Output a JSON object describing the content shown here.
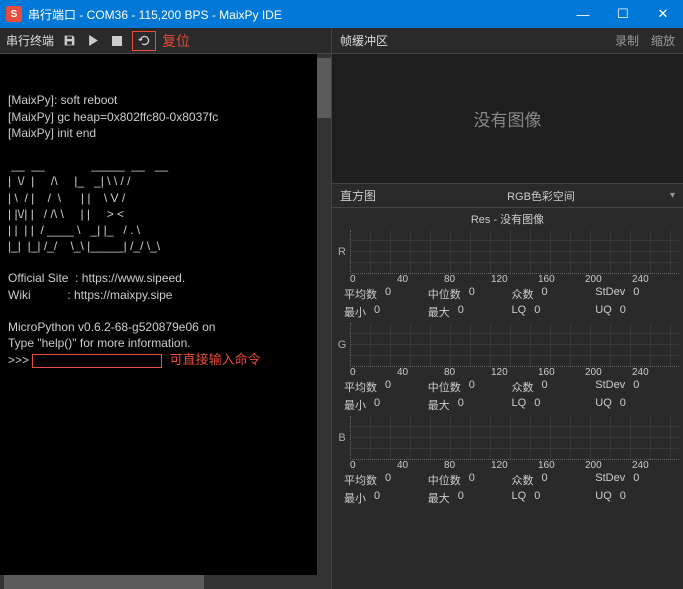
{
  "titlebar": {
    "app_icon": "S",
    "title": "串行端口 - COM36 - 115,200 BPS - MaixPy IDE"
  },
  "win": {
    "min": "—",
    "max": "☐",
    "close": "✕"
  },
  "left_toolbar": {
    "label": "串行终端",
    "annotation_reset": "复位",
    "annotation_input": "可直接输入命令"
  },
  "terminal_text": "[MaixPy]: soft reboot\n[MaixPy] gc heap=0x802ffc80-0x8037fc\n[MaixPy] init end\n\n __  __              _____  __   __\n|  \\/  |     /\\     |_   _| \\ \\ / /\n| \\  / |    /  \\      | |    \\ V /\n| |\\/| |   / /\\ \\     | |     > <\n| |  | |  / ____ \\   _| |_   / . \\\n|_|  |_| /_/    \\_\\ |_____| /_/ \\_\\\n\nOfficial Site  : https://www.sipeed.\nWiki           : https://maixpy.sipe\n\nMicroPython v0.6.2-68-g520879e06 on \nType \"help()\" for more information.",
  "prompt": ">>> ",
  "right_toolbar": {
    "label": "帧缓冲区",
    "rec": "录制",
    "zoom": "缩放"
  },
  "noimage": "没有图像",
  "histogram": {
    "label": "直方图",
    "colorspace": "RGB色彩空间",
    "res_prefix": "Res  - ",
    "res_value": "没有图像"
  },
  "x_ticks": [
    "0",
    "40",
    "80",
    "120",
    "160",
    "200",
    "240"
  ],
  "channels": [
    "R",
    "G",
    "B"
  ],
  "stat_labels": {
    "mean": "平均数",
    "median": "中位数",
    "mode": "众数",
    "stdev": "StDev",
    "min": "最小",
    "max": "最大",
    "lq": "LQ",
    "uq": "UQ"
  },
  "stat_zero": "0",
  "chart_data": [
    {
      "channel": "R",
      "type": "bar",
      "x_range": [
        0,
        255
      ],
      "values": [],
      "stats": {
        "mean": 0,
        "median": 0,
        "mode": 0,
        "stdev": 0,
        "min": 0,
        "max": 0,
        "lq": 0,
        "uq": 0
      }
    },
    {
      "channel": "G",
      "type": "bar",
      "x_range": [
        0,
        255
      ],
      "values": [],
      "stats": {
        "mean": 0,
        "median": 0,
        "mode": 0,
        "stdev": 0,
        "min": 0,
        "max": 0,
        "lq": 0,
        "uq": 0
      }
    },
    {
      "channel": "B",
      "type": "bar",
      "x_range": [
        0,
        255
      ],
      "values": [],
      "stats": {
        "mean": 0,
        "median": 0,
        "mode": 0,
        "stdev": 0,
        "min": 0,
        "max": 0,
        "lq": 0,
        "uq": 0
      }
    }
  ]
}
